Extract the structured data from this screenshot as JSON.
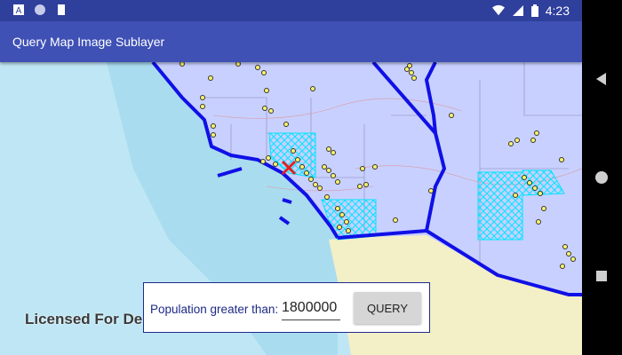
{
  "status_bar": {
    "time": "4:23",
    "left_icons": [
      "text-notification-icon",
      "circle-notification-icon",
      "sd-card-icon"
    ],
    "right_icons": [
      "wifi-icon",
      "signal-icon",
      "battery-icon"
    ]
  },
  "app_bar": {
    "title": "Query Map Image Sublayer"
  },
  "map": {
    "watermark": "Licensed For De",
    "colors": {
      "ocean": "#bfe6f4",
      "land_desert": "#f3efc6",
      "selected_state": "#c8d0ff",
      "state_border": "#1010e6",
      "county_highlight": "#00e5ff",
      "city_point": "#fff56a"
    }
  },
  "query_panel": {
    "label": "Population greater than:",
    "input_value": "1800000",
    "button_label": "QUERY"
  },
  "nav_bar": {
    "buttons": [
      "back-icon",
      "home-icon",
      "recents-icon"
    ]
  }
}
